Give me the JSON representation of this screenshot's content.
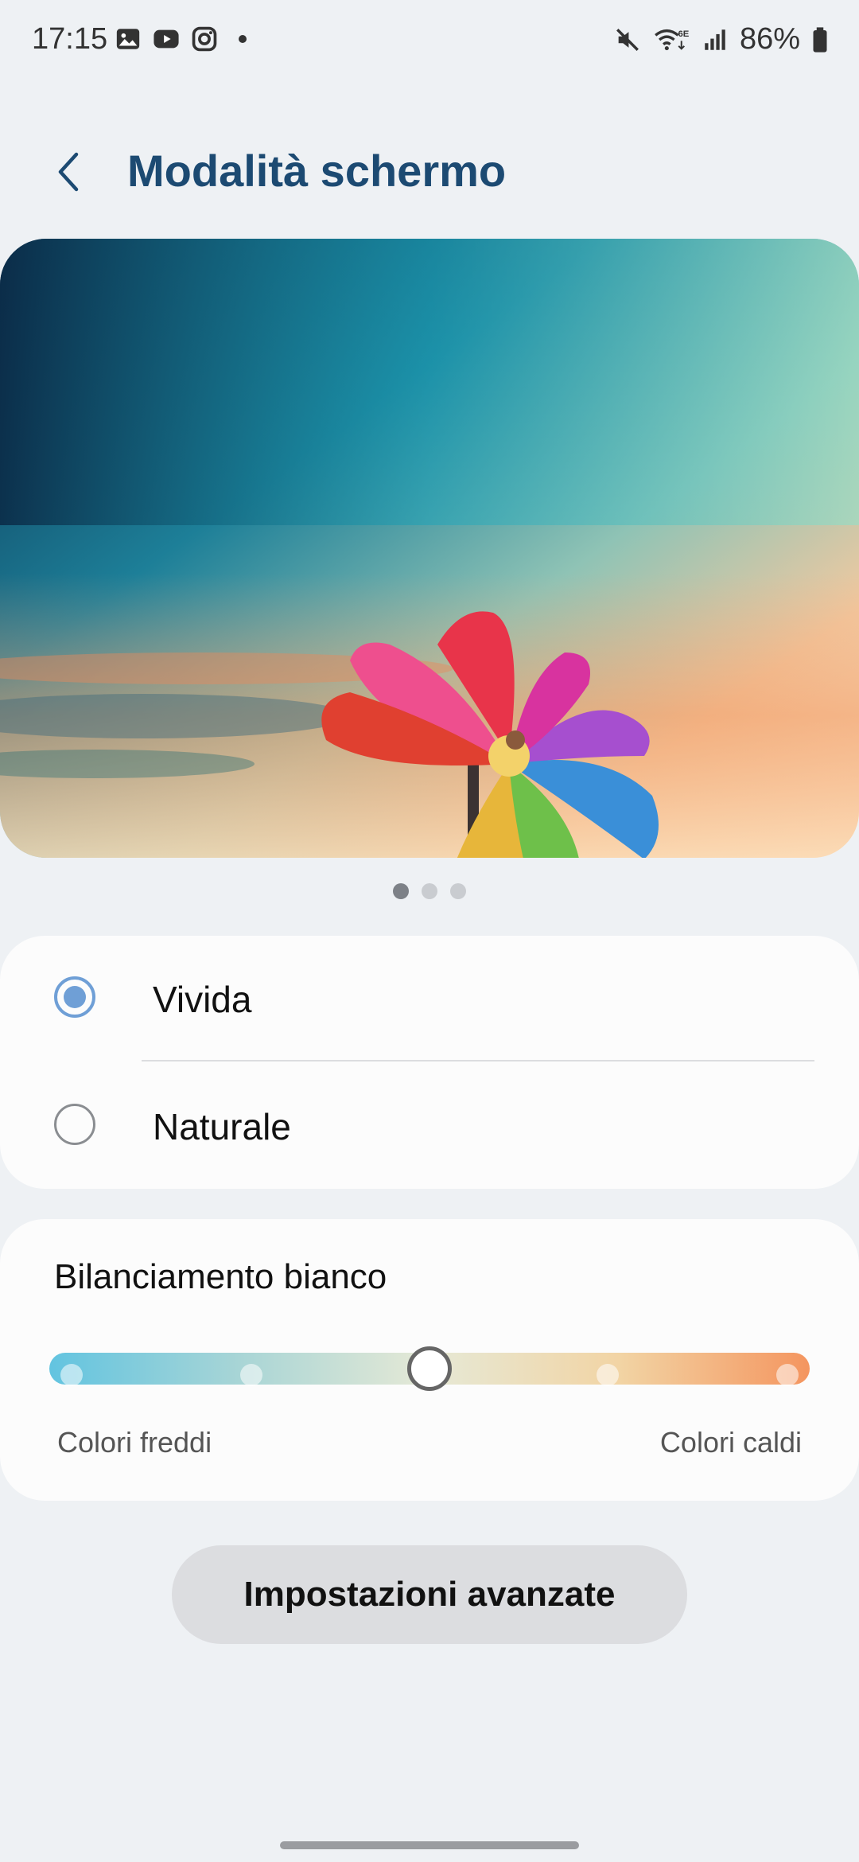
{
  "status_bar": {
    "time": "17:15",
    "battery": "86%",
    "left_icons": [
      "gallery-icon",
      "youtube-icon",
      "instagram-icon",
      "notification-dot"
    ],
    "right_icons": [
      "mute-icon",
      "wifi-6e-icon",
      "signal-icon",
      "battery-icon"
    ]
  },
  "header": {
    "title": "Modalità schermo"
  },
  "preview": {
    "pages": 3,
    "active_page": 1
  },
  "screen_mode": {
    "options": [
      {
        "label": "Vivida",
        "selected": true
      },
      {
        "label": "Naturale",
        "selected": false
      }
    ]
  },
  "white_balance": {
    "title": "Bilanciamento bianco",
    "min_label": "Colori freddi",
    "max_label": "Colori caldi",
    "steps": 5,
    "value_step": 3
  },
  "advanced_button": {
    "label": "Impostazioni avanzate"
  },
  "colors": {
    "title": "#1c4a72",
    "radio_selected": "#6f9fd6",
    "background": "#eef1f4",
    "card": "#fcfcfc"
  }
}
